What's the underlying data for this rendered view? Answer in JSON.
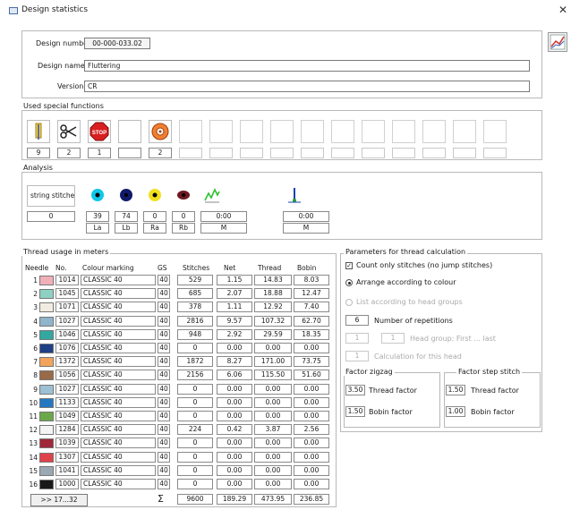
{
  "window": {
    "title": "Design statistics"
  },
  "header": {
    "design_number_label": "Design number",
    "design_number": "00-000-033.02",
    "design_name_label": "Design name",
    "design_name": "Fluttering",
    "version_label": "Version",
    "version": "CR"
  },
  "special": {
    "title": "Used special functions",
    "values": [
      "9",
      "2",
      "1",
      "",
      "2",
      "",
      "",
      "",
      "",
      "",
      "",
      "",
      "",
      "",
      "",
      ""
    ]
  },
  "analysis": {
    "title": "Analysis",
    "string_label": "string stitche",
    "string_value": "0",
    "values": [
      "39",
      "74",
      "0",
      "0",
      "0:00",
      "0:00"
    ],
    "units": [
      "La",
      "Lb",
      "Ra",
      "Rb",
      "M",
      "M"
    ]
  },
  "thread": {
    "title": "Thread usage in meters",
    "headers": [
      "Needle",
      "No.",
      "Colour marking",
      "GS",
      "Stitches",
      "Net",
      "Thread",
      "Bobin"
    ],
    "rows": [
      {
        "n": "1",
        "no": "1014",
        "name": "CLASSIC 40",
        "gs": "40",
        "st": "529",
        "net": "1.15",
        "thr": "14.83",
        "bob": "8.03",
        "color": "#f0b0b8"
      },
      {
        "n": "2",
        "no": "1045",
        "name": "CLASSIC 40",
        "gs": "40",
        "st": "685",
        "net": "2.07",
        "thr": "18.88",
        "bob": "12.47",
        "color": "#8fd0c4"
      },
      {
        "n": "3",
        "no": "1071",
        "name": "CLASSIC 40",
        "gs": "40",
        "st": "378",
        "net": "1.11",
        "thr": "12.92",
        "bob": "7.40",
        "color": "#f2ece0"
      },
      {
        "n": "4",
        "no": "1027",
        "name": "CLASSIC 40",
        "gs": "40",
        "st": "2816",
        "net": "9.57",
        "thr": "107.32",
        "bob": "62.70",
        "color": "#8fb4cc"
      },
      {
        "n": "5",
        "no": "1046",
        "name": "CLASSIC 40",
        "gs": "40",
        "st": "948",
        "net": "2.92",
        "thr": "29.59",
        "bob": "18.35",
        "color": "#33a8a0"
      },
      {
        "n": "6",
        "no": "1076",
        "name": "CLASSIC 40",
        "gs": "40",
        "st": "0",
        "net": "0.00",
        "thr": "0.00",
        "bob": "0.00",
        "color": "#1f3f86"
      },
      {
        "n": "7",
        "no": "1372",
        "name": "CLASSIC 40",
        "gs": "40",
        "st": "1872",
        "net": "8.27",
        "thr": "171.00",
        "bob": "73.75",
        "color": "#f2a45a"
      },
      {
        "n": "8",
        "no": "1056",
        "name": "CLASSIC 40",
        "gs": "40",
        "st": "2156",
        "net": "6.06",
        "thr": "115.50",
        "bob": "51.60",
        "color": "#9a6a48"
      },
      {
        "n": "9",
        "no": "1027",
        "name": "CLASSIC 40",
        "gs": "40",
        "st": "0",
        "net": "0.00",
        "thr": "0.00",
        "bob": "0.00",
        "color": "#9cc0d4"
      },
      {
        "n": "10",
        "no": "1133",
        "name": "CLASSIC 40",
        "gs": "40",
        "st": "0",
        "net": "0.00",
        "thr": "0.00",
        "bob": "0.00",
        "color": "#2478c2"
      },
      {
        "n": "11",
        "no": "1049",
        "name": "CLASSIC 40",
        "gs": "40",
        "st": "0",
        "net": "0.00",
        "thr": "0.00",
        "bob": "0.00",
        "color": "#6aa84a"
      },
      {
        "n": "12",
        "no": "1284",
        "name": "CLASSIC 40",
        "gs": "40",
        "st": "224",
        "net": "0.42",
        "thr": "3.87",
        "bob": "2.56",
        "color": "#f4f4f4"
      },
      {
        "n": "13",
        "no": "1039",
        "name": "CLASSIC 40",
        "gs": "40",
        "st": "0",
        "net": "0.00",
        "thr": "0.00",
        "bob": "0.00",
        "color": "#a02838"
      },
      {
        "n": "14",
        "no": "1307",
        "name": "CLASSIC 40",
        "gs": "40",
        "st": "0",
        "net": "0.00",
        "thr": "0.00",
        "bob": "0.00",
        "color": "#e0424a"
      },
      {
        "n": "15",
        "no": "1041",
        "name": "CLASSIC 40",
        "gs": "40",
        "st": "0",
        "net": "0.00",
        "thr": "0.00",
        "bob": "0.00",
        "color": "#9aa8b4"
      },
      {
        "n": "16",
        "no": "1000",
        "name": "CLASSIC 40",
        "gs": "40",
        "st": "0",
        "net": "0.00",
        "thr": "0.00",
        "bob": "0.00",
        "color": "#181818"
      }
    ],
    "more_button": ">> 17...32",
    "sigma": "Σ",
    "totals": {
      "st": "9600",
      "net": "189.29",
      "thr": "473.95",
      "bob": "236.85"
    }
  },
  "params": {
    "title": "Parameters for thread calculation",
    "count_only": "Count only stitches (no jump stitches)",
    "arrange_colour": "Arrange according to colour",
    "list_head": "List according to head groups",
    "repetitions_value": "6",
    "repetitions_label": "Number of repetitions",
    "head_first": "1",
    "head_last": "1",
    "head_group_label": "Head group: First ... last",
    "calc_head_value": "1",
    "calc_head_label": "Calculation for this head",
    "zigzag_title": "Factor zigzag",
    "step_title": "Factor step stitch",
    "zigzag_thread": "3.50",
    "zigzag_bobin": "1.50",
    "step_thread": "1.50",
    "step_bobin": "1.00",
    "thread_factor": "Thread factor",
    "bobin_factor": "Bobin factor"
  }
}
